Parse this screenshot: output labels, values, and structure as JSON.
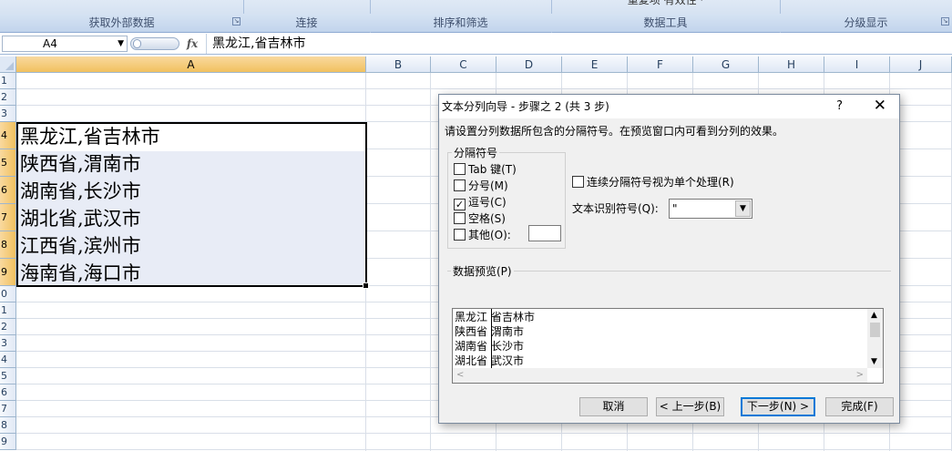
{
  "ribbon": {
    "groups": [
      {
        "label": "获取外部数据",
        "cut": ""
      },
      {
        "label": "连接",
        "cut": ""
      },
      {
        "label": "排序和筛选",
        "cut": ""
      },
      {
        "label": "数据工具",
        "cut": "重复项  有效性 ·"
      },
      {
        "label": "分级显示",
        "cut": ""
      }
    ]
  },
  "formula_bar": {
    "name_box": "A4",
    "fx": "fx",
    "content": "黑龙江,省吉林市"
  },
  "sheet": {
    "columns": [
      "A",
      "B",
      "C",
      "D",
      "E",
      "F",
      "G",
      "H",
      "I",
      "J"
    ],
    "rows": [
      "1",
      "2",
      "3",
      "4",
      "5",
      "6",
      "7",
      "8",
      "9",
      "0",
      "1",
      "2",
      "3",
      "4",
      "5",
      "6",
      "7",
      "8",
      "9"
    ],
    "cells": [
      "黑龙江,省吉林市",
      "陕西省,渭南市",
      "湖南省,长沙市",
      "湖北省,武汉市",
      "江西省,滨州市",
      "海南省,海口市"
    ]
  },
  "dialog": {
    "title": "文本分列向导 - 步骤之 2 (共 3 步)",
    "help": "?",
    "close": "✕",
    "intro": "请设置分列数据所包含的分隔符号。在预览窗口内可看到分列的效果。",
    "delimiters_legend": "分隔符号",
    "delimiters": [
      {
        "label": "Tab 键(T)",
        "checked": false
      },
      {
        "label": "分号(M)",
        "checked": false
      },
      {
        "label": "逗号(C)",
        "checked": true
      },
      {
        "label": "空格(S)",
        "checked": false
      },
      {
        "label": "其他(O):",
        "checked": false
      }
    ],
    "other_value": "",
    "consecutive_label": "连续分隔符号视为单个处理(R)",
    "consecutive_checked": false,
    "qualifier_label": "文本识别符号(Q):",
    "qualifier_value": "\"",
    "preview_legend": "数据预览(P)",
    "preview_rows": [
      [
        "黑龙江",
        "省吉林市"
      ],
      [
        "陕西省",
        "渭南市"
      ],
      [
        "湖南省",
        "长沙市"
      ],
      [
        "湖北省",
        "武汉市"
      ]
    ],
    "buttons": {
      "cancel": "取消",
      "back": "< 上一步(B)",
      "next": "下一步(N) >",
      "finish": "完成(F)"
    },
    "checkmark": "✓"
  }
}
